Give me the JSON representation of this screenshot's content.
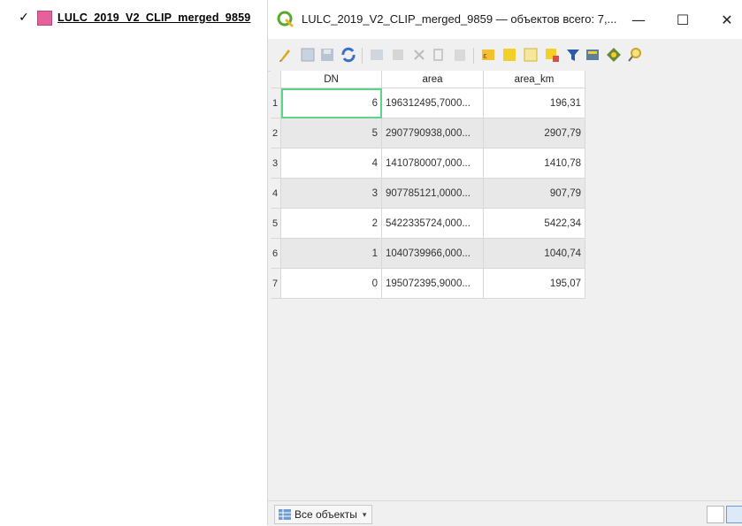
{
  "layers_panel": {
    "layer": {
      "checked": true,
      "checkbox_glyph": "✓",
      "swatch_color": "#e8609a",
      "name": "LULC_2019_V2_CLIP_merged_9859"
    }
  },
  "window": {
    "title": "LULC_2019_V2_CLIP_merged_9859 — объектов всего: 7,...",
    "icon": "qgis-icon",
    "minimize": "—",
    "maximize": "☐",
    "close": "✕"
  },
  "toolbar": {
    "buttons": [
      "edit-pencil-icon",
      "multi-edit-icon",
      "save-icon",
      "reload-icon",
      "add-feature-icon",
      "delete-feature-icon",
      "cut-icon",
      "copy-icon",
      "paste-icon",
      "expression-select-icon",
      "select-all-icon",
      "invert-selection-icon",
      "deselect-icon",
      "filter-icon",
      "move-selection-top-icon",
      "pan-to-selection-icon",
      "zoom-to-selection-icon"
    ]
  },
  "table": {
    "columns": [
      "DN",
      "area",
      "area_km"
    ],
    "rows": [
      {
        "row": "1",
        "DN": "6",
        "area": "196312495,7000...",
        "area_km": "196,31"
      },
      {
        "row": "2",
        "DN": "5",
        "area": "2907790938,000...",
        "area_km": "2907,79"
      },
      {
        "row": "3",
        "DN": "4",
        "area": "1410780007,000...",
        "area_km": "1410,78"
      },
      {
        "row": "4",
        "DN": "3",
        "area": "907785121,0000...",
        "area_km": "907,79"
      },
      {
        "row": "5",
        "DN": "2",
        "area": "5422335724,000...",
        "area_km": "5422,34"
      },
      {
        "row": "6",
        "DN": "1",
        "area": "1040739966,000...",
        "area_km": "1040,74"
      },
      {
        "row": "7",
        "DN": "0",
        "area": "195072395,9000...",
        "area_km": "195,07"
      }
    ],
    "selected_cell": {
      "row": 0,
      "column": "DN"
    }
  },
  "bottom_bar": {
    "filter_label": "Все объекты",
    "filter_chevron": "▾"
  },
  "colors": {
    "selection_outline": "#5fd38a",
    "alt_row": "#e8e8e8",
    "window_bg": "#f0f0f0"
  }
}
